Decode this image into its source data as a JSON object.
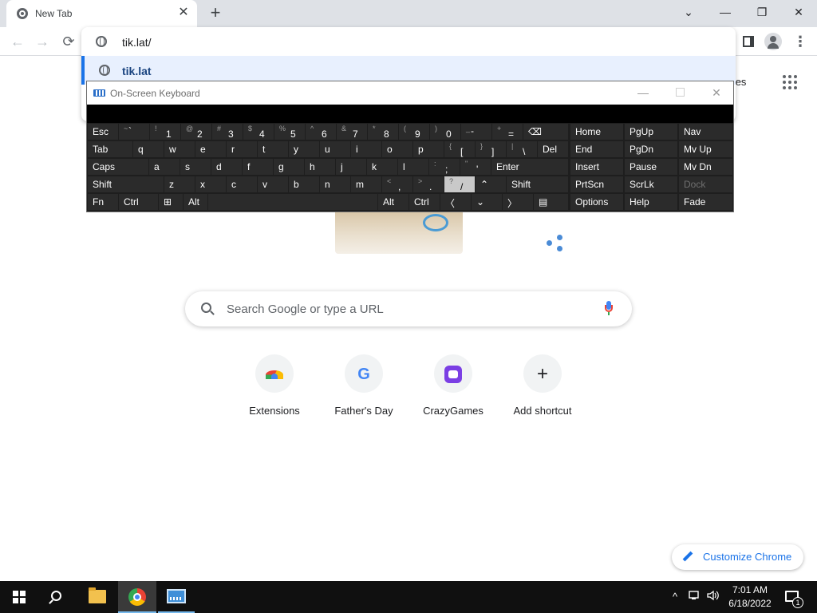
{
  "browser": {
    "tab_title": "New Tab",
    "tab_close": "✕",
    "new_tab": "+",
    "window_controls": {
      "search_tabs": "⌄",
      "minimize": "—",
      "restore": "❐",
      "close": "✕"
    },
    "nav": {
      "back": "←",
      "forward": "→",
      "reload": "⟳"
    },
    "omnibox": {
      "text": "tik.lat/",
      "suggestion": "tik.lat"
    },
    "menu": "⋮"
  },
  "ntp": {
    "images_link": "nages",
    "search_placeholder": "Search Google or type a URL",
    "shortcuts": [
      {
        "label": "Extensions"
      },
      {
        "label": "Father's Day"
      },
      {
        "label": "CrazyGames"
      },
      {
        "label": "Add shortcut"
      }
    ],
    "google_letter": "G",
    "add_symbol": "+",
    "customize_label": "Customize Chrome"
  },
  "osk": {
    "title": "On-Screen Keyboard",
    "minimize": "—",
    "close": "✕",
    "rows": [
      [
        {
          "l": "Esc"
        },
        {
          "s": "~",
          "u": "`"
        },
        {
          "s": "!",
          "m": "1"
        },
        {
          "s": "@",
          "m": "2"
        },
        {
          "s": "#",
          "m": "3"
        },
        {
          "s": "$",
          "m": "4"
        },
        {
          "s": "%",
          "m": "5"
        },
        {
          "s": "^",
          "m": "6"
        },
        {
          "s": "&",
          "m": "7"
        },
        {
          "s": "*",
          "m": "8"
        },
        {
          "s": "(",
          "m": "9"
        },
        {
          "s": ")",
          "m": "0"
        },
        {
          "s": "_",
          "u": "-"
        },
        {
          "s": "+",
          "m": "="
        },
        {
          "l": "⌫"
        }
      ],
      [
        {
          "l": "Tab"
        },
        {
          "l": "q"
        },
        {
          "l": "w"
        },
        {
          "l": "e"
        },
        {
          "l": "r"
        },
        {
          "l": "t"
        },
        {
          "l": "y"
        },
        {
          "l": "u"
        },
        {
          "l": "i"
        },
        {
          "l": "o"
        },
        {
          "l": "p"
        },
        {
          "s": "{",
          "m": "["
        },
        {
          "s": "}",
          "m": "]"
        },
        {
          "s": "|",
          "m": "\\"
        },
        {
          "l": "Del"
        }
      ],
      [
        {
          "l": "Caps"
        },
        {
          "l": "a"
        },
        {
          "l": "s"
        },
        {
          "l": "d"
        },
        {
          "l": "f"
        },
        {
          "l": "g"
        },
        {
          "l": "h"
        },
        {
          "l": "j"
        },
        {
          "l": "k"
        },
        {
          "l": "l"
        },
        {
          "s": ":",
          "m": ";"
        },
        {
          "s": "\"",
          "m": "'"
        },
        {
          "l": "Enter"
        }
      ],
      [
        {
          "l": "Shift"
        },
        {
          "l": "z"
        },
        {
          "l": "x"
        },
        {
          "l": "c"
        },
        {
          "l": "v"
        },
        {
          "l": "b"
        },
        {
          "l": "n"
        },
        {
          "l": "m"
        },
        {
          "s": "<",
          "m": ","
        },
        {
          "s": ">",
          "m": "."
        },
        {
          "s": "?",
          "m": "/",
          "pressed": true
        },
        {
          "l": "⌃"
        },
        {
          "l": "Shift"
        }
      ],
      [
        {
          "l": "Fn"
        },
        {
          "l": "Ctrl"
        },
        {
          "l": "⊞"
        },
        {
          "l": "Alt"
        },
        {
          "l": ""
        },
        {
          "l": "Alt"
        },
        {
          "l": "Ctrl"
        },
        {
          "l": "〈"
        },
        {
          "l": "⌄"
        },
        {
          "l": "〉"
        },
        {
          "l": "▤"
        }
      ]
    ],
    "side": [
      [
        {
          "l": "Home"
        },
        {
          "l": "PgUp"
        },
        {
          "l": "Nav"
        }
      ],
      [
        {
          "l": "End"
        },
        {
          "l": "PgDn"
        },
        {
          "l": "Mv Up"
        }
      ],
      [
        {
          "l": "Insert"
        },
        {
          "l": "Pause"
        },
        {
          "l": "Mv Dn"
        }
      ],
      [
        {
          "l": "PrtScn"
        },
        {
          "l": "ScrLk"
        },
        {
          "l": "Dock",
          "disabled": true
        }
      ],
      [
        {
          "l": "Options"
        },
        {
          "l": "Help"
        },
        {
          "l": "Fade"
        }
      ]
    ]
  },
  "taskbar": {
    "time": "7:01 AM",
    "date": "6/18/2022",
    "tray_chevron": "^",
    "notification_count": "1"
  }
}
